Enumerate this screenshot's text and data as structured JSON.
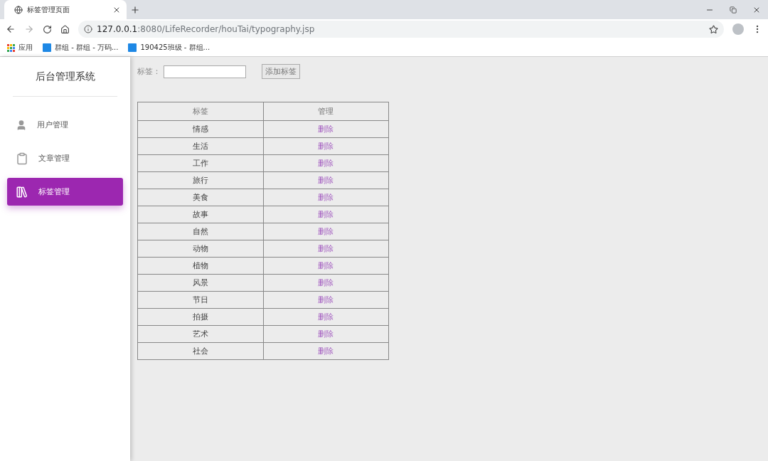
{
  "browser": {
    "tab_title": "标签管理页面",
    "url_host": "127.0.0.1",
    "url_path": ":8080/LifeRecorder/houTai/typography.jsp",
    "bookmarks": [
      {
        "label": "应用",
        "kind": "apps"
      },
      {
        "label": "群组 - 群组 - 万码...",
        "kind": "site"
      },
      {
        "label": "190425班级 - 群组...",
        "kind": "site"
      }
    ]
  },
  "sidebar": {
    "title": "后台管理系统",
    "items": [
      {
        "label": "用户管理",
        "kind": "user",
        "selected": false
      },
      {
        "label": "文章管理",
        "kind": "clipboard",
        "selected": false
      },
      {
        "label": "标签管理",
        "kind": "library",
        "selected": true
      }
    ]
  },
  "form": {
    "label": "标签：",
    "button": "添加标签"
  },
  "table": {
    "columns": [
      "标签",
      "管理"
    ],
    "rows": [
      {
        "tag": "情感",
        "action": "删除"
      },
      {
        "tag": "生活",
        "action": "删除"
      },
      {
        "tag": "工作",
        "action": "删除"
      },
      {
        "tag": "旅行",
        "action": "删除"
      },
      {
        "tag": "美食",
        "action": "删除"
      },
      {
        "tag": "故事",
        "action": "删除"
      },
      {
        "tag": "自然",
        "action": "删除"
      },
      {
        "tag": "动物",
        "action": "删除"
      },
      {
        "tag": "植物",
        "action": "删除"
      },
      {
        "tag": "风景",
        "action": "删除"
      },
      {
        "tag": "节日",
        "action": "删除"
      },
      {
        "tag": "拍摄",
        "action": "删除"
      },
      {
        "tag": "艺术",
        "action": "删除"
      },
      {
        "tag": "社会",
        "action": "删除"
      }
    ]
  }
}
